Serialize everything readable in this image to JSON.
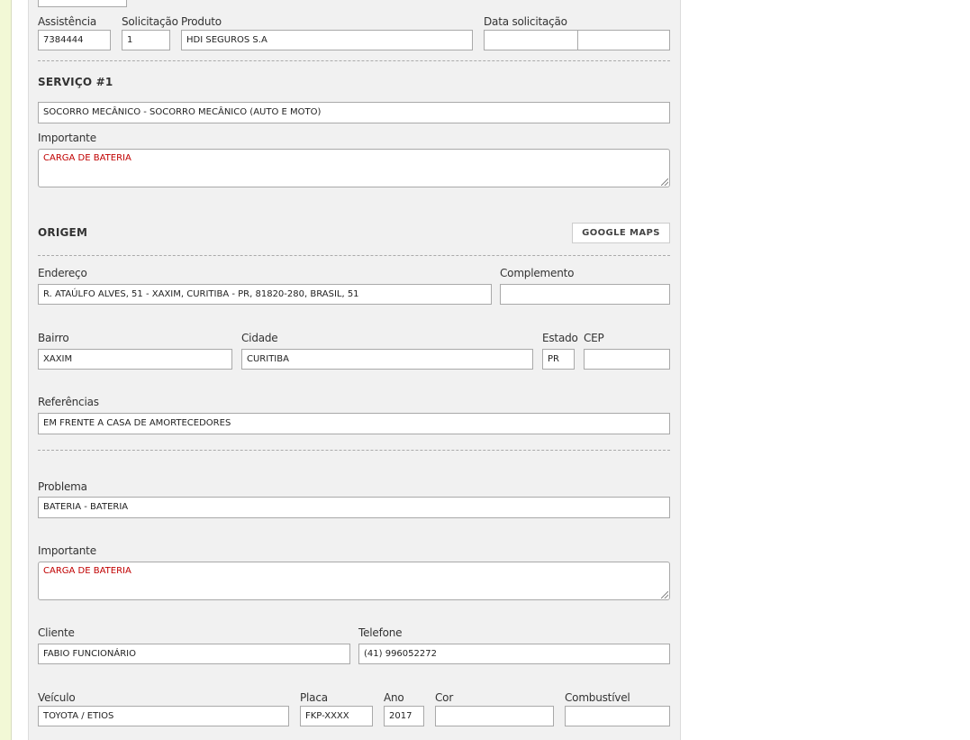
{
  "top": {
    "assistencia_label": "Assistência",
    "assistencia_value": "7384444",
    "solicitacao_label": "Solicitação",
    "solicitacao_value": "1",
    "produto_label": "Produto",
    "produto_value": "HDI SEGUROS S.A",
    "data_label": "Data solicitação",
    "data_value": "",
    "hora_value": ""
  },
  "servico": {
    "title": "SERVIÇO #1",
    "value": "SOCORRO MECÂNICO - SOCORRO MECÂNICO (AUTO E MOTO)",
    "importante_label": "Importante",
    "importante_value": "CARGA DE BATERIA"
  },
  "origem": {
    "title": "ORIGEM",
    "maps_button": "GOOGLE MAPS",
    "endereco_label": "Endereço",
    "endereco_value": "R. ATAÚLFO ALVES, 51 - XAXIM, CURITIBA - PR, 81820-280, BRASIL, 51",
    "complemento_label": "Complemento",
    "complemento_value": "",
    "bairro_label": "Bairro",
    "bairro_value": "XAXIM",
    "cidade_label": "Cidade",
    "cidade_value": "CURITIBA",
    "estado_label": "Estado",
    "estado_value": "PR",
    "cep_label": "CEP",
    "cep_value": "",
    "referencias_label": "Referências",
    "referencias_value": "EM FRENTE A CASA DE AMORTECEDORES"
  },
  "problema": {
    "label": "Problema",
    "value": "BATERIA - BATERIA",
    "importante_label": "Importante",
    "importante_value": "CARGA DE BATERIA"
  },
  "cliente": {
    "label": "Cliente",
    "value": "FABIO FUNCIONÁRIO",
    "telefone_label": "Telefone",
    "telefone_value": "(41) 996052272"
  },
  "veiculo": {
    "label": "Veículo",
    "value": "TOYOTA / ETIOS",
    "placa_label": "Placa",
    "placa_value": "FKP-XXXX",
    "ano_label": "Ano",
    "ano_value": "2017",
    "cor_label": "Cor",
    "cor_value": "",
    "combustivel_label": "Combustível",
    "combustivel_value": ""
  }
}
